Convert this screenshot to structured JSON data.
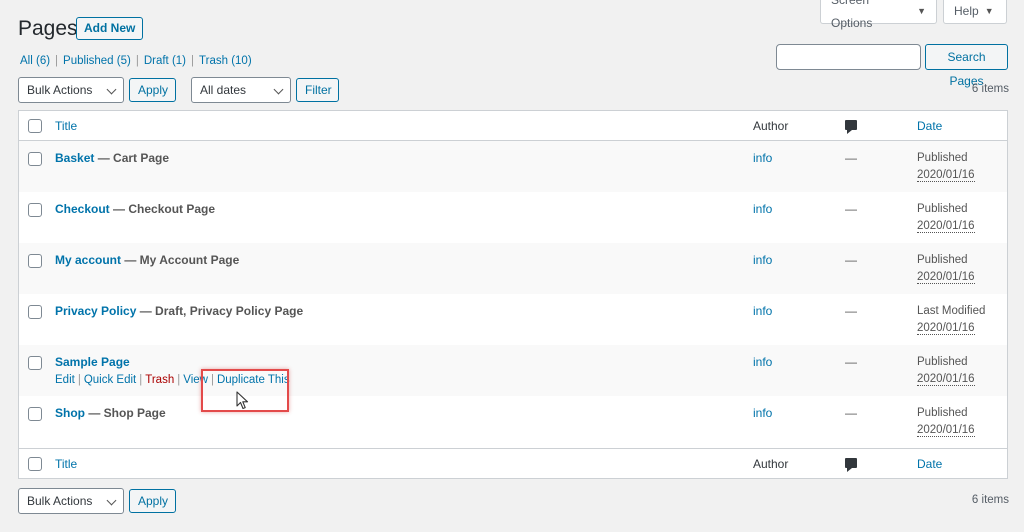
{
  "header": {
    "screen_options": "Screen Options",
    "help": "Help",
    "title": "Pages",
    "add_new": "Add New"
  },
  "filters": {
    "all": "All",
    "all_count": "(6)",
    "published": "Published",
    "published_count": "(5)",
    "draft": "Draft",
    "draft_count": "(1)",
    "trash": "Trash",
    "trash_count": "(10)"
  },
  "search": {
    "value": "",
    "button": "Search Pages"
  },
  "toolbar": {
    "bulk_actions": "Bulk Actions",
    "apply": "Apply",
    "dates": "All dates",
    "filter": "Filter",
    "items_count": "6 items"
  },
  "table": {
    "columns": {
      "title": "Title",
      "author": "Author",
      "date": "Date"
    },
    "rows": [
      {
        "title": "Basket",
        "suffix": " — Cart Page",
        "author": "info",
        "comments": "—",
        "status": "Published",
        "date": "2020/01/16"
      },
      {
        "title": "Checkout",
        "suffix": " — Checkout Page",
        "author": "info",
        "comments": "—",
        "status": "Published",
        "date": "2020/01/16"
      },
      {
        "title": "My account",
        "suffix": " — My Account Page",
        "author": "info",
        "comments": "—",
        "status": "Published",
        "date": "2020/01/16"
      },
      {
        "title": "Privacy Policy",
        "suffix": " — Draft, Privacy Policy Page",
        "author": "info",
        "comments": "—",
        "status": "Last Modified",
        "date": "2020/01/16"
      },
      {
        "title": "Sample Page",
        "suffix": "",
        "author": "info",
        "comments": "—",
        "status": "Published",
        "date": "2020/01/16"
      },
      {
        "title": "Shop",
        "suffix": " — Shop Page",
        "author": "info",
        "comments": "—",
        "status": "Published",
        "date": "2020/01/16"
      }
    ],
    "row_actions": {
      "edit": "Edit",
      "quick_edit": "Quick Edit",
      "trash": "Trash",
      "view": "View",
      "duplicate": "Duplicate This"
    }
  },
  "icons": {
    "comments_header": "comment-bubble-icon",
    "cursor": "mouse-pointer-icon"
  },
  "colors": {
    "link": "#0073aa",
    "trash": "#aa0000",
    "highlight": "#e34a4a"
  }
}
